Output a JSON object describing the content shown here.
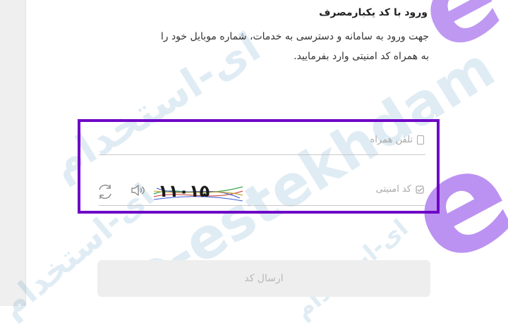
{
  "login": {
    "title": "ورود با کد یکبارمصرف",
    "desc_line1": "جهت ورود به سامانه و دسترسی به خدمات، شماره موبایل خود را",
    "desc_line2": "به همراه کد امنیتی وارد بفرمایید."
  },
  "form": {
    "phone_label": "تلفن همراه",
    "captcha_label": "کد امنیتی",
    "captcha_text": "۱۱۰۱۵"
  },
  "actions": {
    "submit_label": "ارسال کد"
  },
  "watermark": {
    "text_fa": "ای-استخدام",
    "text_en": "e-estekhdam",
    "brand_letter": "e"
  },
  "colors": {
    "highlight_border": "#6f07c7",
    "brand": "#b07ff0",
    "watermark": "#2a7fb3"
  }
}
